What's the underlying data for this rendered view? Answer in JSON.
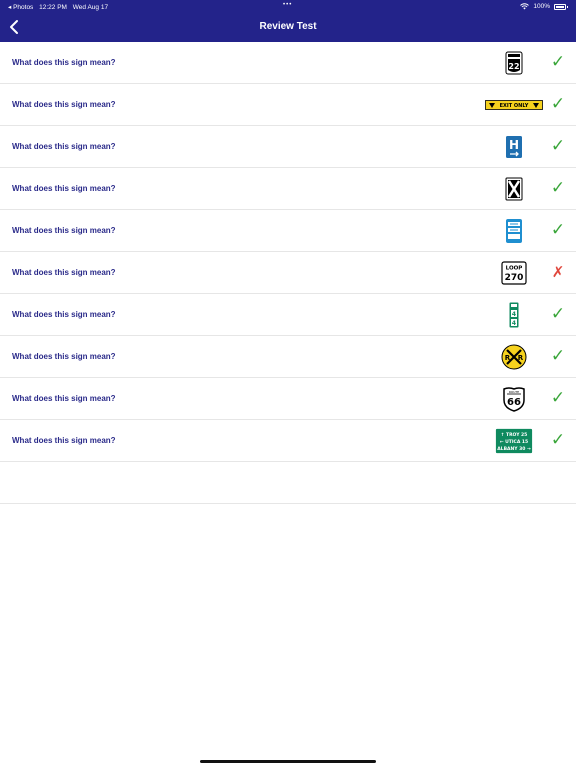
{
  "status_bar": {
    "back_app": "◂ Photos",
    "time": "12:22 PM",
    "date": "Wed Aug 17",
    "multitask": "•••",
    "battery_pct": "100%"
  },
  "nav": {
    "title": "Review Test"
  },
  "questions": [
    {
      "text": "What does this sign mean?",
      "sign": "us-route-22-sign-icon",
      "result": "✓"
    },
    {
      "text": "What does this sign mean?",
      "sign": "exit-only-sign-icon",
      "result": "✓",
      "sign_text": "EXIT ONLY"
    },
    {
      "text": "What does this sign mean?",
      "sign": "hospital-sign-icon",
      "result": "✓",
      "sign_text": "H"
    },
    {
      "text": "What does this sign mean?",
      "sign": "crossbuck-x-sign-icon",
      "result": "✓"
    },
    {
      "text": "What does this sign mean?",
      "sign": "blue-info-sign-icon",
      "result": "✓"
    },
    {
      "text": "What does this sign mean?",
      "sign": "loop-270-sign-icon",
      "result": "✗",
      "sign_text_top": "LOOP",
      "sign_text_num": "270"
    },
    {
      "text": "What does this sign mean?",
      "sign": "mile-marker-sign-icon",
      "result": "✓"
    },
    {
      "text": "What does this sign mean?",
      "sign": "railroad-crossing-sign-icon",
      "result": "✓",
      "sign_text_left": "R",
      "sign_text_right": "R"
    },
    {
      "text": "What does this sign mean?",
      "sign": "route-66-shield-icon",
      "result": "✓",
      "sign_text_num": "66"
    },
    {
      "text": "What does this sign mean?",
      "sign": "destination-guide-sign-icon",
      "result": "✓",
      "sign_lines": [
        "↑ TROY 25",
        "← UTICA 15",
        "ALBANY 30 →"
      ]
    }
  ],
  "colors": {
    "header_bg": "#23238a",
    "question_text": "#2b2b8a",
    "correct": "#3aa63a",
    "incorrect": "#e0463c",
    "highway_green": "#0f8a5f",
    "info_blue": "#1f6fb0",
    "warning_yellow": "#f6d21e"
  }
}
